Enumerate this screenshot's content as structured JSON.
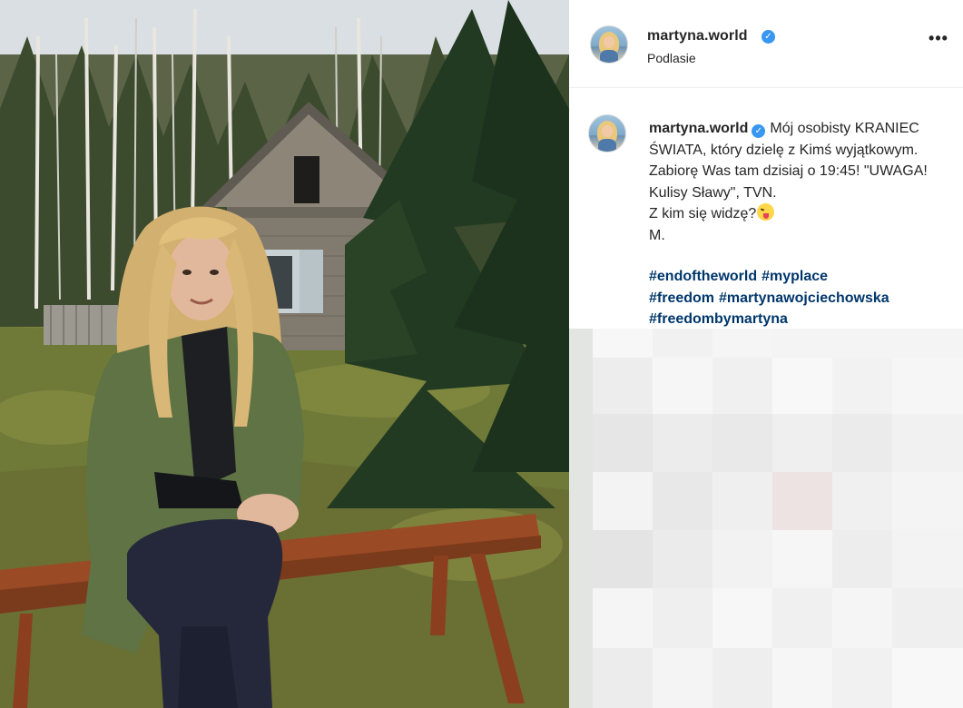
{
  "post": {
    "username": "martyna.world",
    "verified_icon": "verified-badge-icon",
    "location": "Podlasie",
    "more_icon": "more-options-icon",
    "more_label": "•••"
  },
  "caption": {
    "username": "martyna.world",
    "text": "Mój osobisty KRANIEC ŚWIATA, który dzielę z Kimś wyjątkowym. Zabiorę Was tam dzisiaj o 19:45! \"UWAGA! Kulisy Sławy\", TVN.\nZ kim się widzę?",
    "emoji": "winking-face-with-tongue",
    "signature": "M.",
    "hashtags": [
      "#endoftheworld",
      "#myplace",
      "#freedom",
      "#martynawojciechowska",
      "#freedombymartyna"
    ]
  },
  "colors": {
    "hashtag": "#00376b",
    "verified": "#3897f0",
    "text": "#262626",
    "divider": "#efefef"
  }
}
